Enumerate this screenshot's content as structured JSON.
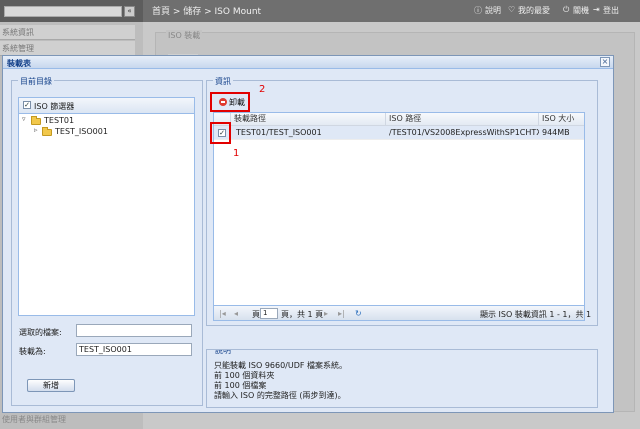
{
  "background": {
    "breadcrumb": "首頁 > 儲存 > ISO Mount",
    "top_links": {
      "help": "說明",
      "favorites": "我的最愛",
      "shutdown": "關機",
      "logout": "登出"
    },
    "sidebar_items": [
      "系統資訊",
      "系統管理"
    ],
    "panel_legend": "ISO 裝載",
    "bottom_text": "使用者與群組管理"
  },
  "modal": {
    "title": "裝載表",
    "left": {
      "legend": "目前目錄",
      "tree_root": "ISO 篩選器",
      "tree_nodes": [
        "TEST01",
        "TEST_ISO001"
      ],
      "selected_file_label": "選取的檔案:",
      "selected_file_value": "",
      "mount_as_label": "裝載為:",
      "mount_as_value": "TEST_ISO001",
      "add_button": "新增"
    },
    "right": {
      "legend": "資訊",
      "unmount_button": "卸載",
      "columns": [
        "裝載路徑",
        "ISO 路徑",
        "ISO 大小"
      ],
      "rows": [
        {
          "checked": true,
          "mount_path": "TEST01/TEST_ISO001",
          "iso_path": "/TEST01/VS2008ExpressWithSP1CHTX...",
          "size": "944MB"
        }
      ],
      "pager": {
        "page_prefix": "頁",
        "page_value": "1",
        "page_suffix": "頁，共 1 頁",
        "summary": "顯示 ISO 裝載資訊 1 - 1，共 1"
      }
    },
    "description": {
      "legend": "說明",
      "lines": [
        "只能裝載 ISO 9660/UDF 檔案系統。",
        "前 100 個資料夾",
        "前 100 個檔案",
        "請輸入 ISO 的完整路徑 (兩步到達)。"
      ]
    }
  },
  "annotations": {
    "label_1": "1",
    "label_2": "2"
  },
  "colors": {
    "highlight_red": "#e20000",
    "header_blue": "#15428b"
  }
}
